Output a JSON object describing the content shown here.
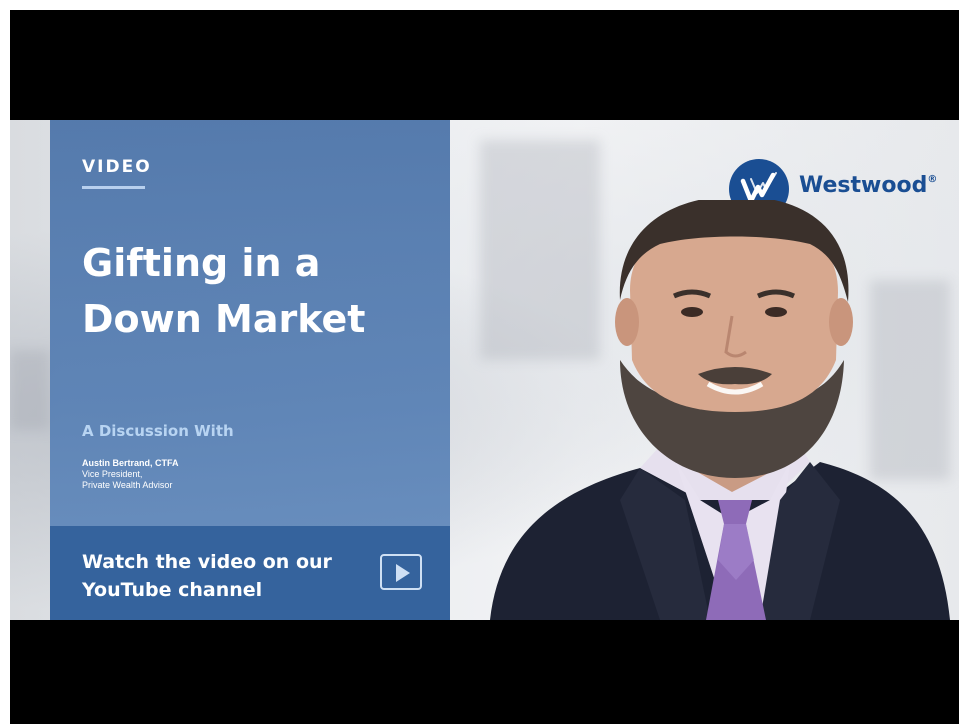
{
  "video": {
    "label": "VIDEO",
    "title_line1": "Gifting in a",
    "title_line2": "Down Market",
    "discussion_label": "A Discussion With",
    "speaker": {
      "name": "Austin Bertrand, CTFA",
      "title_line1": "Vice President,",
      "title_line2": "Private Wealth Advisor"
    },
    "cta": {
      "line1": "Watch the video on our",
      "line2": "YouTube channel",
      "icon": "play-icon"
    }
  },
  "brand": {
    "name": "Westwood",
    "registered": "®",
    "color": "#1a4e93"
  },
  "colors": {
    "panel": "#4f76aa",
    "cta_bar": "#35639d",
    "accent_text": "#b8d4f2",
    "letterbox": "#000000"
  }
}
